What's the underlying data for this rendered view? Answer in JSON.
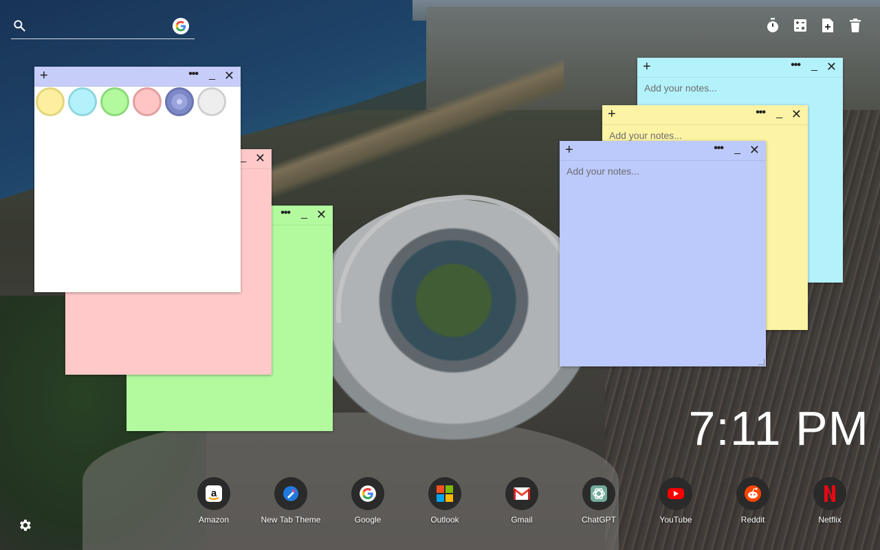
{
  "search": {
    "placeholder": "",
    "value": "",
    "icon": "search-icon",
    "engine_icon": "google-g-icon"
  },
  "tools": [
    {
      "name": "timer-icon"
    },
    {
      "name": "calculator-icon"
    },
    {
      "name": "new-note-icon"
    },
    {
      "name": "trash-icon"
    }
  ],
  "notes": [
    {
      "id": "white",
      "color": "#ffffff",
      "bar_color": "#c7cdf9",
      "add": "+",
      "more": "•••",
      "min": "_",
      "close": "✕",
      "placeholder": ""
    },
    {
      "id": "pink",
      "color": "#ffc9c9",
      "add": "+",
      "more": "•••",
      "min": "_",
      "close": "✕",
      "placeholder": ""
    },
    {
      "id": "green",
      "color": "#b3fa9f",
      "add": "+",
      "more": "•••",
      "min": "_",
      "close": "✕",
      "placeholder": ""
    },
    {
      "id": "cyan",
      "color": "#b3f2fb",
      "add": "+",
      "more": "•••",
      "min": "_",
      "close": "✕",
      "placeholder": "Add your notes..."
    },
    {
      "id": "yellow",
      "color": "#fcf3a4",
      "add": "+",
      "more": "•••",
      "min": "_",
      "close": "✕",
      "placeholder": "Add your notes..."
    },
    {
      "id": "blue",
      "color": "#bcc9fb",
      "add": "+",
      "more": "•••",
      "min": "_",
      "close": "✕",
      "placeholder": "Add your notes..."
    }
  ],
  "palette": [
    {
      "name": "yellow",
      "fill": "#fcef9f",
      "ring": "#e3d57a"
    },
    {
      "name": "cyan",
      "fill": "#b3f2fb",
      "ring": "#8ed6e0"
    },
    {
      "name": "green",
      "fill": "#b3fa9f",
      "ring": "#8cd97a"
    },
    {
      "name": "pink",
      "fill": "#ffc4c4",
      "ring": "#e39f9f"
    },
    {
      "name": "lavender",
      "fill": "#7d88c7",
      "ring": "#6a74b0",
      "selected": true
    },
    {
      "name": "gray",
      "fill": "#eeeeee",
      "ring": "#cfcfcf"
    }
  ],
  "clock": "7:11 PM",
  "dock": [
    {
      "label": "Amazon",
      "icon": "amazon-icon"
    },
    {
      "label": "New Tab Theme",
      "icon": "new-tab-theme-icon"
    },
    {
      "label": "Google",
      "icon": "google-icon"
    },
    {
      "label": "Outlook",
      "icon": "outlook-icon"
    },
    {
      "label": "Gmail",
      "icon": "gmail-icon"
    },
    {
      "label": "ChatGPT",
      "icon": "chatgpt-icon"
    },
    {
      "label": "YouTube",
      "icon": "youtube-icon"
    },
    {
      "label": "Reddit",
      "icon": "reddit-icon"
    },
    {
      "label": "Netflix",
      "icon": "netflix-icon"
    }
  ],
  "settings_icon": "gear-icon"
}
